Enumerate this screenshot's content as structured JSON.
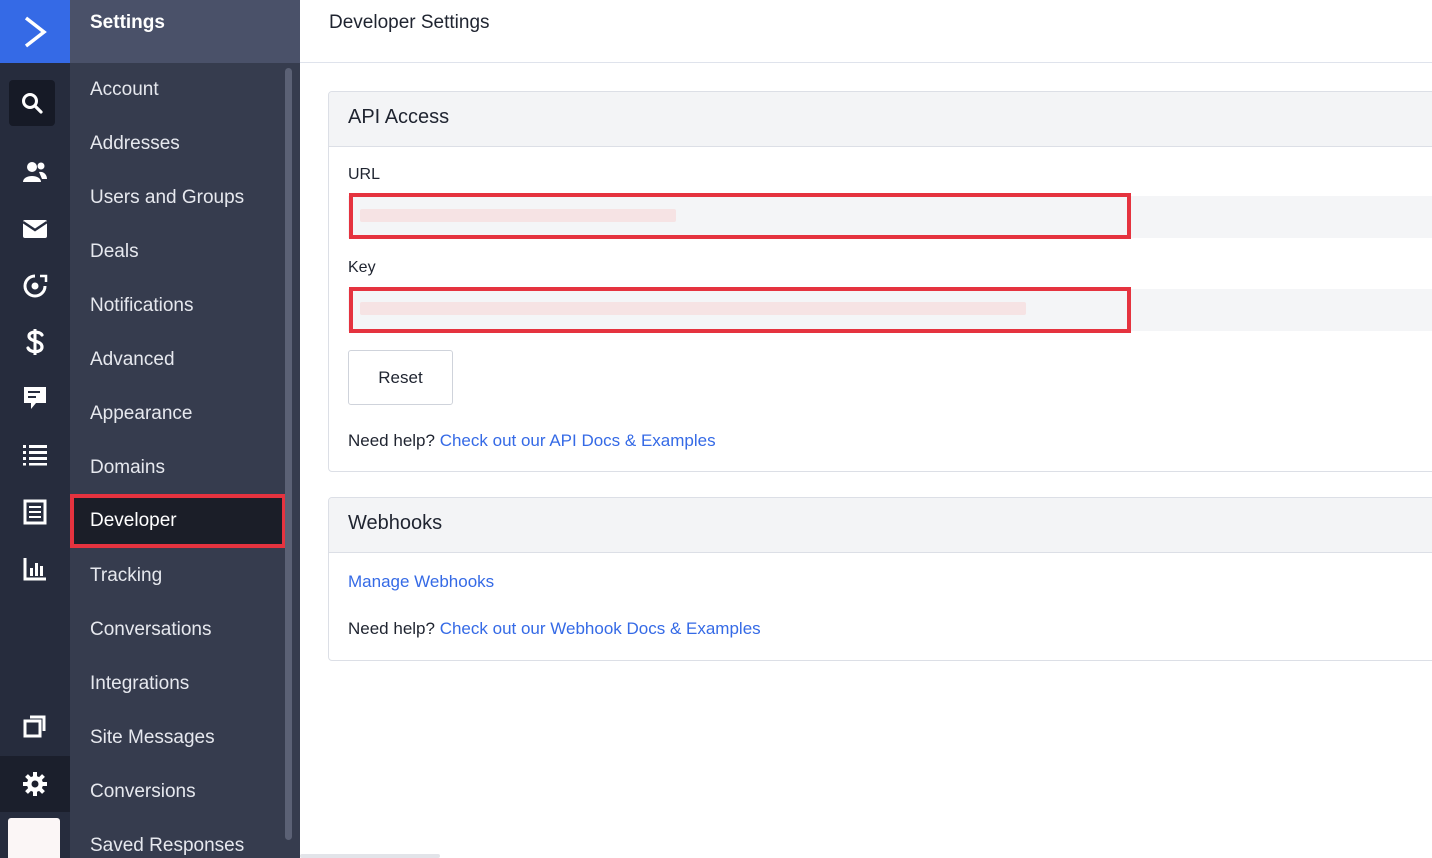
{
  "app": {
    "logo_icon": "chevron-right-logo-icon",
    "brand_color": "#356ae6",
    "accent_red": "#e5333f"
  },
  "rail": {
    "icons": [
      "search-icon",
      "contacts-icon",
      "email-icon",
      "automation-icon",
      "dollar-icon",
      "chat-icon",
      "list-icon",
      "document-icon",
      "reports-icon",
      "pages-icon",
      "gear-icon",
      "avatar"
    ]
  },
  "sidebar": {
    "title": "Settings",
    "items": [
      {
        "label": "Account"
      },
      {
        "label": "Addresses"
      },
      {
        "label": "Users and Groups"
      },
      {
        "label": "Deals"
      },
      {
        "label": "Notifications"
      },
      {
        "label": "Advanced"
      },
      {
        "label": "Appearance"
      },
      {
        "label": "Domains"
      },
      {
        "label": "Developer",
        "active": true
      },
      {
        "label": "Tracking"
      },
      {
        "label": "Conversations"
      },
      {
        "label": "Integrations"
      },
      {
        "label": "Site Messages"
      },
      {
        "label": "Conversions"
      },
      {
        "label": "Saved Responses"
      }
    ]
  },
  "header": {
    "title": "Developer Settings"
  },
  "api_access": {
    "title": "API Access",
    "url_label": "URL",
    "key_label": "Key",
    "reset_label": "Reset",
    "help_prefix": "Need help?",
    "help_link": "Check out our API Docs & Examples"
  },
  "webhooks": {
    "title": "Webhooks",
    "manage_link": "Manage Webhooks",
    "help_prefix": "Need help?",
    "help_link": "Check out our Webhook Docs & Examples"
  }
}
